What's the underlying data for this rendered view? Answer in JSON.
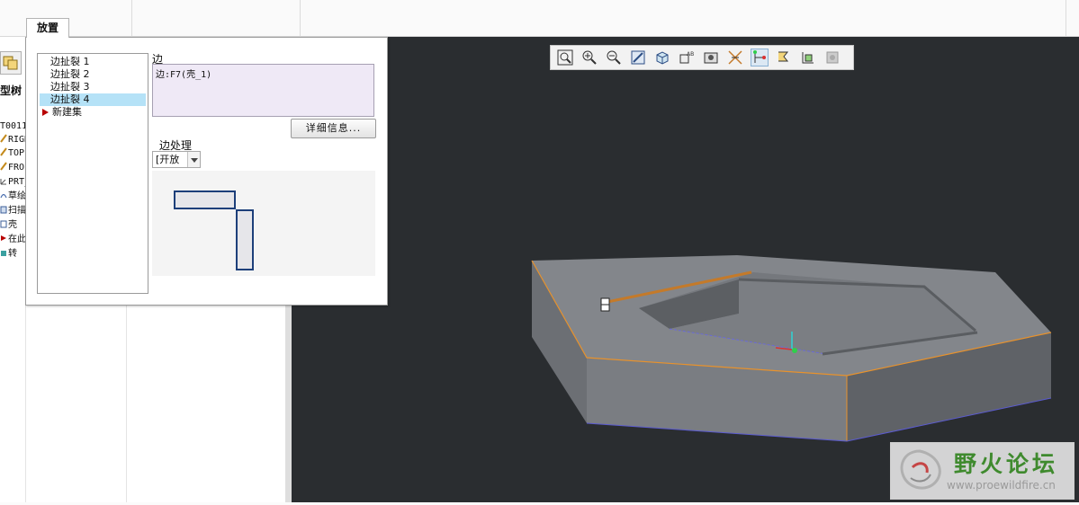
{
  "dialog": {
    "tab_label": "放置",
    "set_items": [
      "边扯裂 1",
      "边扯裂 2",
      "边扯裂 3",
      "边扯裂 4"
    ],
    "selected_index": 3,
    "new_set_label": "新建集",
    "edge_label": "边",
    "edge_value": "边:F7(壳_1)",
    "details_button": "详细信息...",
    "edge_treatment_label": "边处理",
    "edge_treatment_value": "[开放"
  },
  "model_tree": {
    "heading": "型树",
    "rows": [
      "T0011",
      "RIGH",
      "TOP",
      "FROI",
      "PRT_",
      "草绘",
      "扫描",
      "壳",
      "在此",
      "转"
    ]
  },
  "view_toolbar": {
    "icons": [
      "refit-icon",
      "zoom-in-icon",
      "zoom-out-icon",
      "repaint-icon",
      "view-orientation-icon",
      "saved-views-icon",
      "display-style-icon",
      "datum-display-icon",
      "spin-center-icon",
      "annotation-display-icon",
      "layer-icon",
      "render-icon"
    ],
    "active_icon": "spin-center-icon"
  },
  "watermark": {
    "title": "野火论坛",
    "url": "www.proewildfire.cn"
  },
  "colors": {
    "graphics_bg": "#2a2d30",
    "model_face": "#7d8085",
    "selection_edge": "#e8922c",
    "list_selection": "#b5e2f7",
    "edge_box_bg": "#efe9f6",
    "watermark_green": "#3f8a2e"
  }
}
